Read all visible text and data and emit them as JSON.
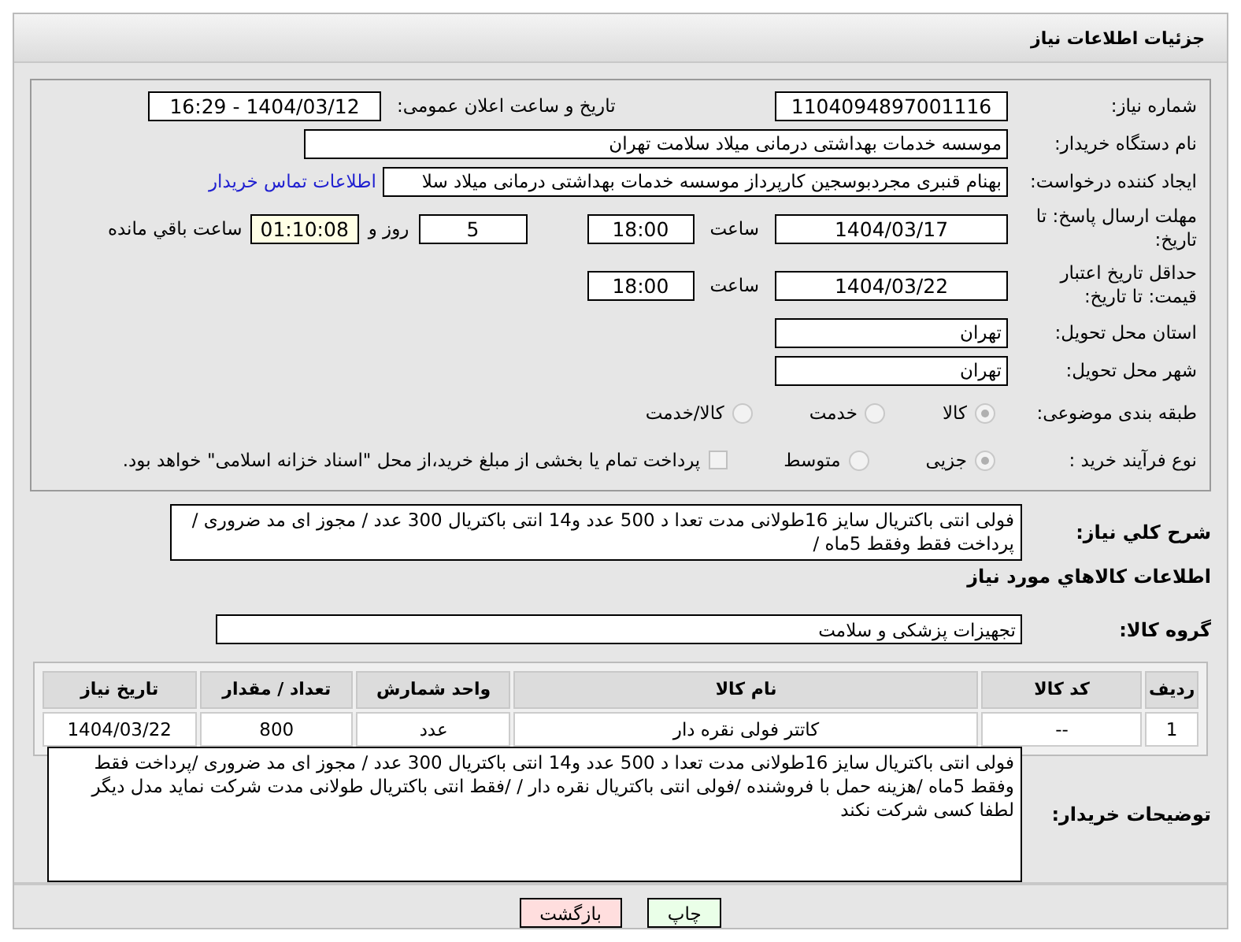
{
  "header": {
    "title": "جزئیات اطلاعات نیاز"
  },
  "need_number": {
    "label": "شماره نیاز:",
    "value": "1104094897001116"
  },
  "announce": {
    "label": "تاریخ و ساعت اعلان عمومی:",
    "value": "1404/03/12 - 16:29"
  },
  "buyer_org": {
    "label": "نام دستگاه خریدار:",
    "value": "موسسه خدمات بهداشتی درمانی میلاد سلامت تهران"
  },
  "requester": {
    "label": "ایجاد کننده درخواست:",
    "value": "بهنام قنبری مجردبوسجین کارپرداز موسسه خدمات بهداشتی درمانی میلاد سلا",
    "link": "اطلاعات تماس خریدار"
  },
  "reply_deadline": {
    "label": "مهلت ارسال پاسخ: تا تاریخ:",
    "date": "1404/03/17",
    "time_label": "ساعت",
    "time": "18:00",
    "days": "5",
    "days_label": "روز و",
    "remaining": "01:10:08",
    "remaining_label": "ساعت باقي مانده"
  },
  "price_validity": {
    "label": "حداقل تاریخ اعتبار قیمت: تا تاریخ:",
    "date": "1404/03/22",
    "time_label": "ساعت",
    "time": "18:00"
  },
  "province": {
    "label": "استان محل تحویل:",
    "value": "تهران"
  },
  "city": {
    "label": "شهر محل تحویل:",
    "value": "تهران"
  },
  "category": {
    "label": "طبقه بندی موضوعی:",
    "options": [
      {
        "label": "کالا",
        "selected": true
      },
      {
        "label": "خدمت",
        "selected": false
      },
      {
        "label": "کالا/خدمت",
        "selected": false
      }
    ]
  },
  "purchase_type": {
    "label": "نوع فرآیند خرید :",
    "options": [
      {
        "label": "جزیی",
        "selected": true
      },
      {
        "label": "متوسط",
        "selected": false
      }
    ],
    "treasury": {
      "label": "پرداخت تمام یا بخشی از مبلغ خرید،از محل \"اسناد خزانه اسلامی\" خواهد بود.",
      "checked": false
    }
  },
  "description": {
    "label": "شرح کلي نياز:",
    "value": "فولی انتی باکتریال سایز  16طولانی مدت تعدا د 500 عدد و14 انتی باکتریال 300 عدد   / مجوز ای مد ضروری / پرداخت فقط وفقط 5ماه /"
  },
  "goods_heading": "اطلاعات كالاهاي مورد نياز",
  "goods_group": {
    "label": "گروه کالا:",
    "value": "تجهیزات پزشکی و سلامت"
  },
  "table": {
    "columns": [
      "ردیف",
      "کد کالا",
      "نام کالا",
      "واحد شمارش",
      "تعداد / مقدار",
      "تاریخ نیاز"
    ],
    "rows": [
      [
        "1",
        "--",
        "کاتتر فولی نقره دار",
        "عدد",
        "800",
        "1404/03/22"
      ]
    ]
  },
  "buyer_notes": {
    "label": "توضیحات خریدار:",
    "value": "فولی انتی باکتریال سایز  16طولانی مدت تعدا د 500 عدد و14 انتی باکتریال 300 عدد   / مجوز ای مد ضروری /پرداخت فقط وفقط 5ماه /هزینه حمل با فروشنده /فولی انتی باکتریال نقره دار   /  /فقط انتی باکتریال طولانی مدت شرکت نماید مدل دیگر لطفا کسی شرکت نکند"
  },
  "buttons": [
    {
      "label": "چاپ",
      "kind": "print"
    },
    {
      "label": "بازگشت",
      "kind": "back"
    }
  ]
}
